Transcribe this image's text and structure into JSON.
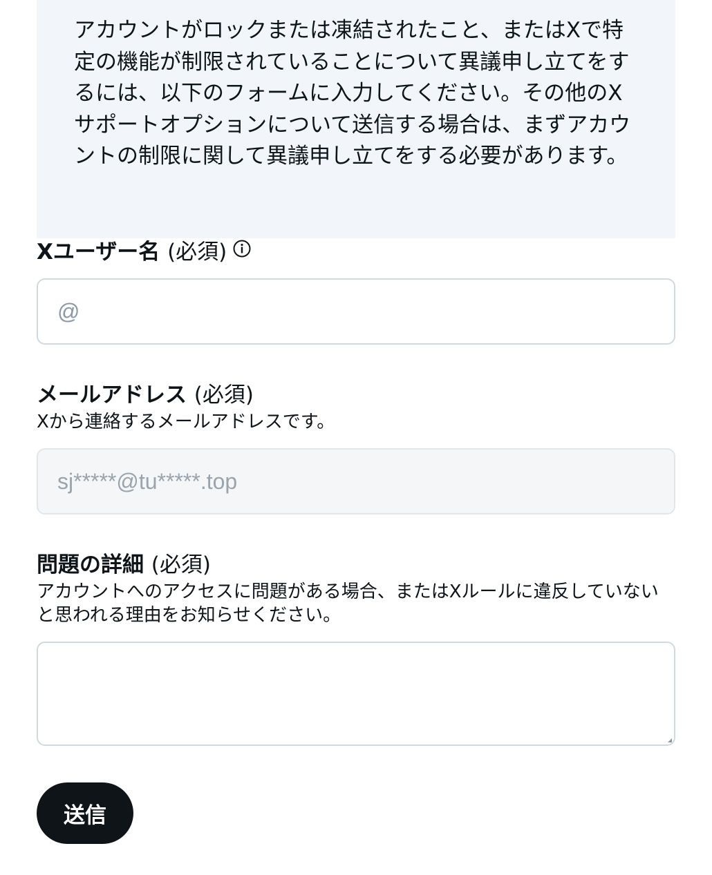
{
  "notice": {
    "text": "アカウントがロックまたは凍結されたこと、またはXで特定の機能が制限されていることについて異議申し立てをするには、以下のフォームに入力してください。その他のXサポートオプションについて送信する場合は、まずアカウントの制限に関して異議申し立てをする必要があります。"
  },
  "username": {
    "label": "Xユーザー名",
    "required": "(必須)",
    "icon": "info-circle-icon",
    "placeholder": "@"
  },
  "email": {
    "label": "メールアドレス",
    "required": "(必須)",
    "description": "Xから連絡するメールアドレスです。",
    "placeholder": "sj*****@tu*****.top"
  },
  "details": {
    "label": "問題の詳細",
    "required": "(必須)",
    "description": "アカウントへのアクセスに問題がある場合、またはXルールに違反していないと思われる理由をお知らせください。"
  },
  "submit": {
    "label": "送信"
  },
  "colors": {
    "notice_bg": "#f2f5f9",
    "text": "#0f1419",
    "border": "#cfd9de",
    "button_bg": "#0f1419",
    "button_text": "#ffffff"
  }
}
